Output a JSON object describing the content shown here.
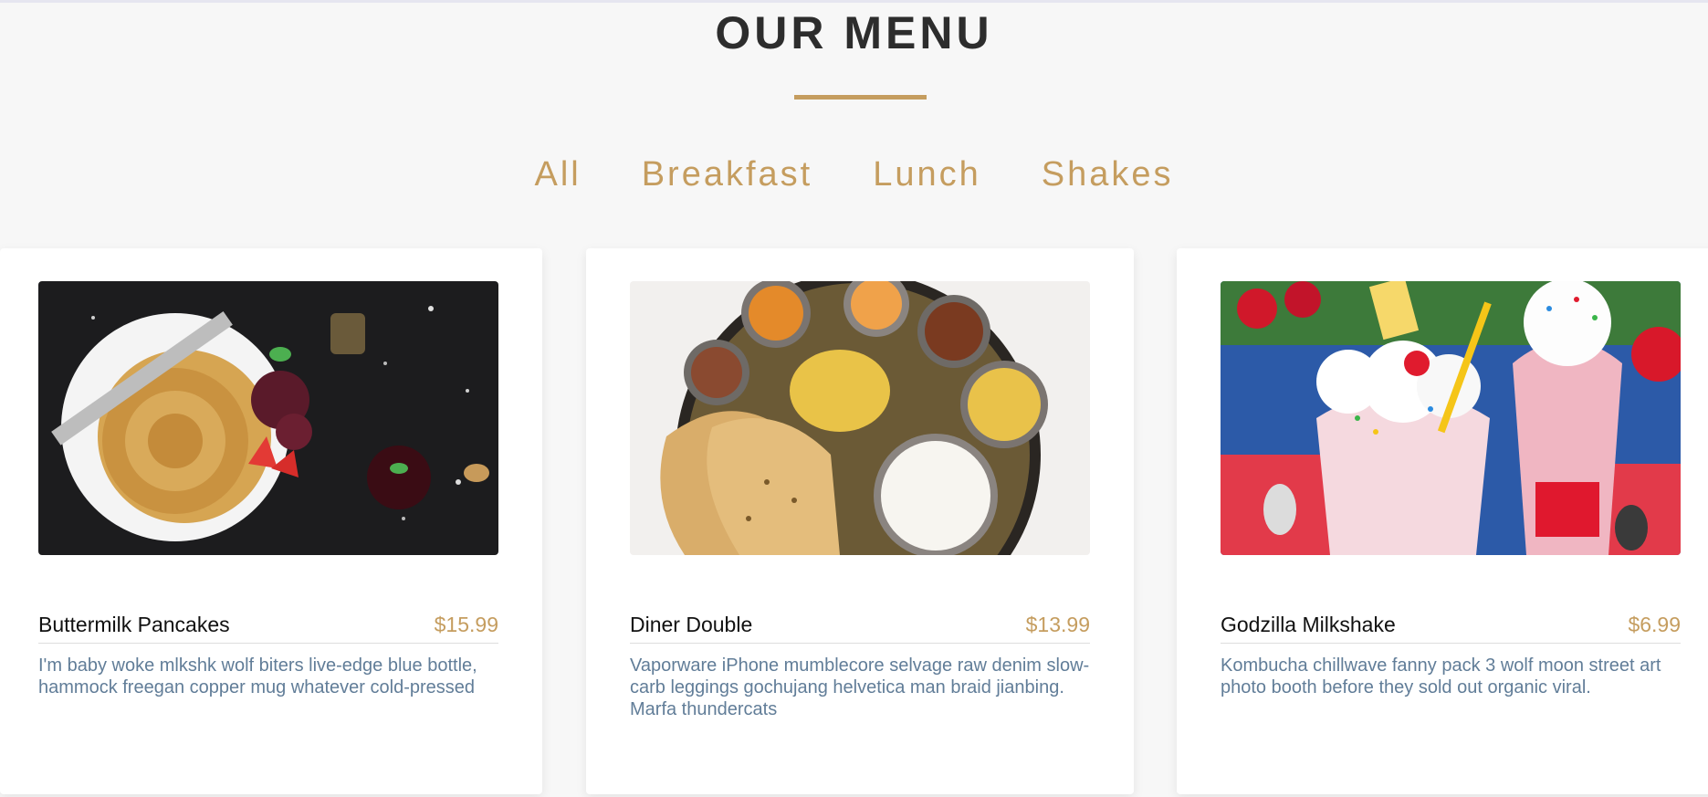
{
  "header": {
    "title": "OUR MENU",
    "accent_color": "#c59d5f"
  },
  "filters": [
    "All",
    "Breakfast",
    "Lunch",
    "Shakes"
  ],
  "menu": [
    {
      "name": "Buttermilk Pancakes",
      "price": "$15.99",
      "description": "I'm baby woke mlkshk wolf biters live-edge blue bottle, hammock freegan copper mug whatever cold-pressed",
      "image": "pancakes-photo"
    },
    {
      "name": "Diner Double",
      "price": "$13.99",
      "description": "Vaporware iPhone mumblecore selvage raw denim slow-carb leggings gochujang helvetica man braid jianbing. Marfa thundercats",
      "image": "thali-photo"
    },
    {
      "name": "Godzilla Milkshake",
      "price": "$6.99",
      "description": "Kombucha chillwave fanny pack 3 wolf moon street art photo booth before they sold out organic viral.",
      "image": "milkshake-photo"
    }
  ]
}
